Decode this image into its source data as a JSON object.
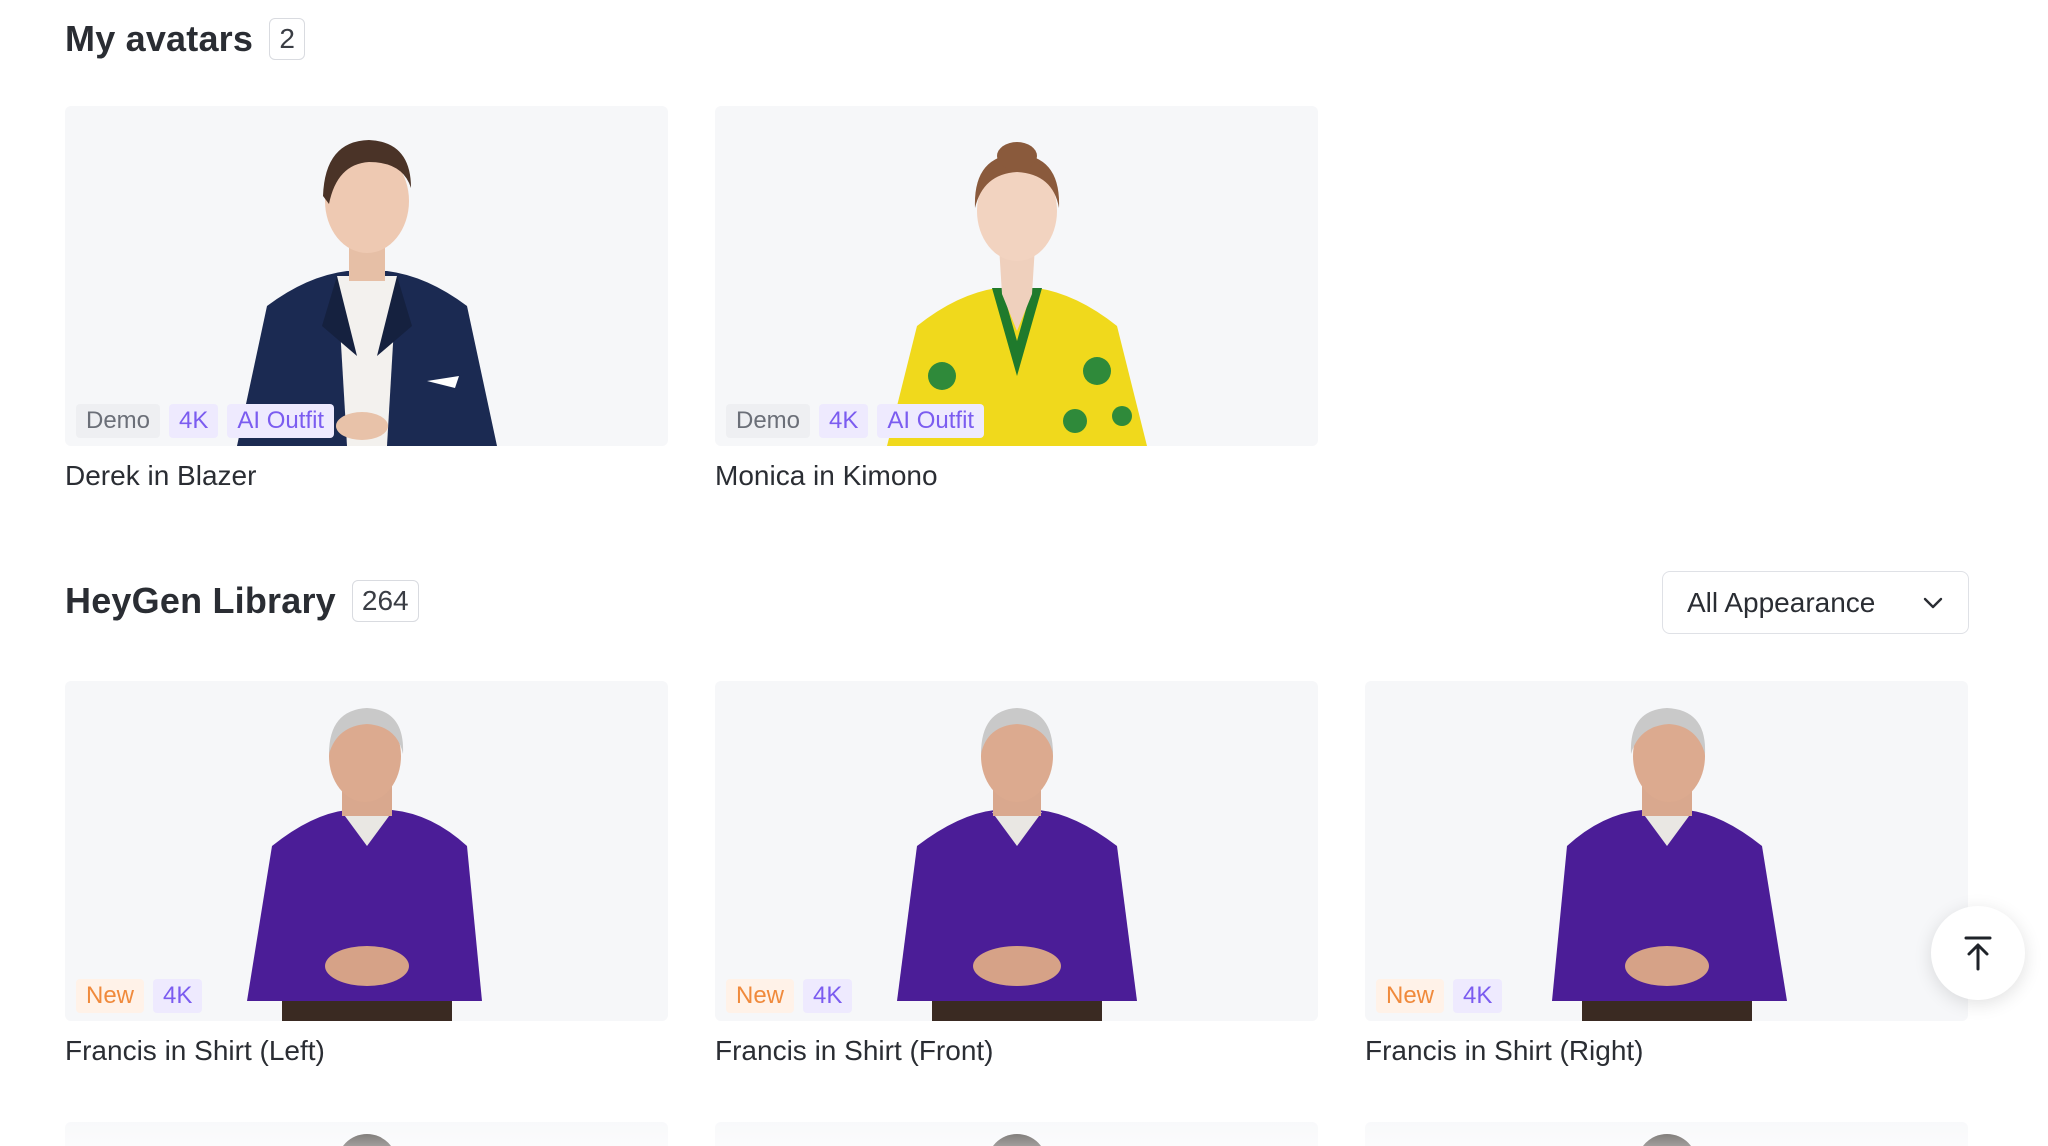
{
  "my_avatars": {
    "title": "My avatars",
    "count": "2",
    "cards": [
      {
        "name": "Derek in Blazer",
        "tags": [
          "Demo",
          "4K",
          "AI Outfit"
        ]
      },
      {
        "name": "Monica in Kimono",
        "tags": [
          "Demo",
          "4K",
          "AI Outfit"
        ]
      }
    ]
  },
  "library": {
    "title": "HeyGen Library",
    "count": "264",
    "filter": {
      "selected": "All Appearance"
    },
    "cards": [
      {
        "name": "Francis in Shirt (Left)",
        "tags": [
          "New",
          "4K"
        ]
      },
      {
        "name": "Francis in Shirt (Front)",
        "tags": [
          "New",
          "4K"
        ]
      },
      {
        "name": "Francis in Shirt (Right)",
        "tags": [
          "New",
          "4K"
        ]
      }
    ]
  },
  "icons": {
    "dropdown": "chevron-down-icon",
    "scroll_top": "arrow-up-to-top-icon"
  },
  "colors": {
    "accent_purple": "#7b5cf0",
    "tag_new": "#f08a3c",
    "thumb_bg": "#f6f7f9"
  }
}
